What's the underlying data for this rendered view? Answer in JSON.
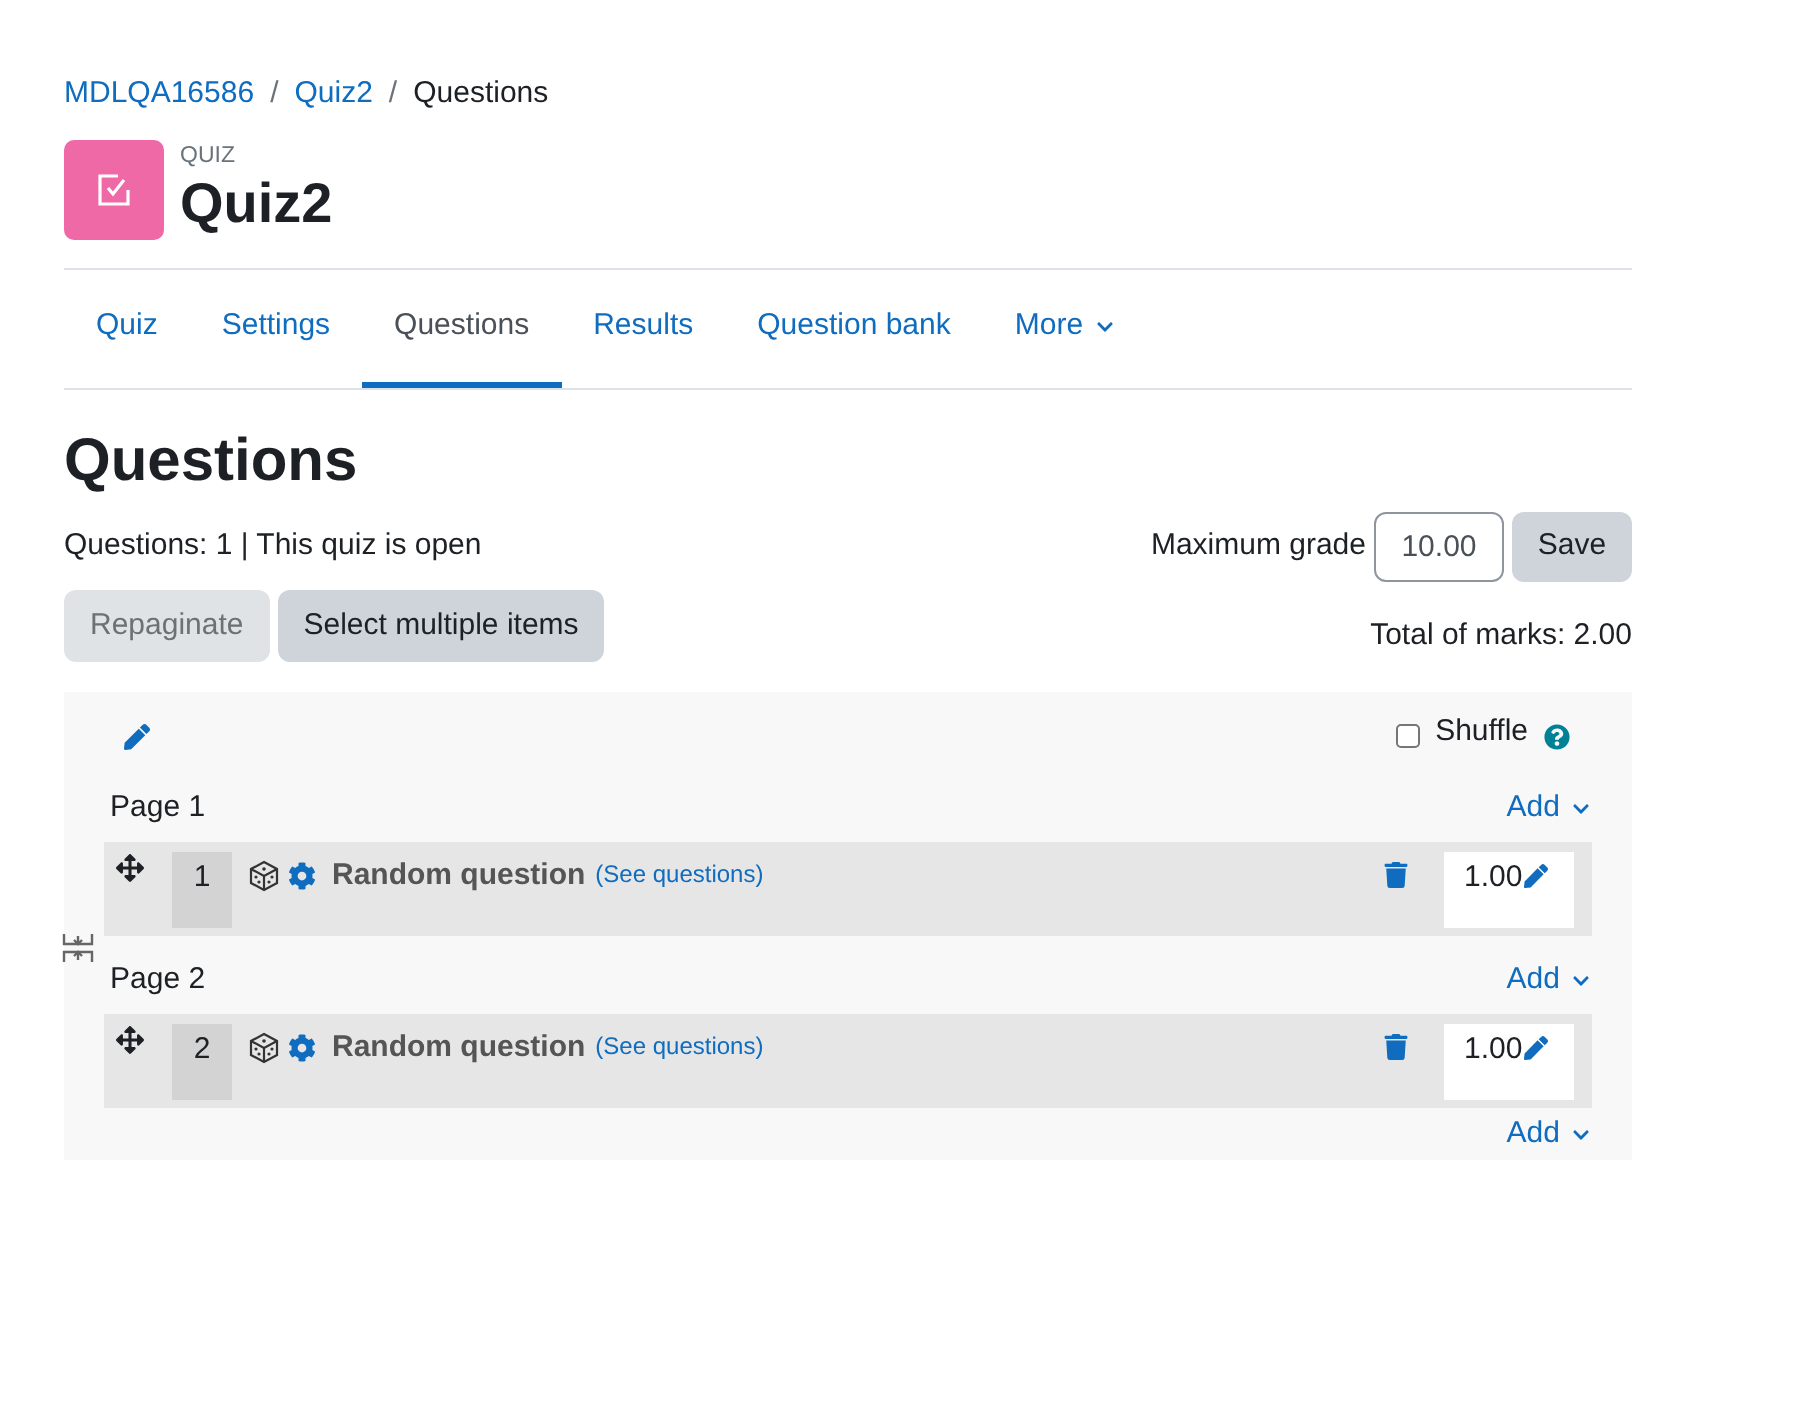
{
  "breadcrumb": [
    {
      "label": "MDLQA16586",
      "link": true
    },
    {
      "separator": "/",
      "label": "Quiz2",
      "link": true
    },
    {
      "separator": "/",
      "label": "Questions",
      "link": false
    }
  ],
  "header": {
    "module_type": "QUIZ",
    "title": "Quiz2"
  },
  "tabs": [
    {
      "label": "Quiz",
      "selected": false,
      "dropdown": false
    },
    {
      "label": "Settings",
      "selected": false,
      "dropdown": false
    },
    {
      "label": "Questions",
      "selected": true,
      "dropdown": false
    },
    {
      "label": "Results",
      "selected": false,
      "dropdown": false
    },
    {
      "label": "Question bank",
      "selected": false,
      "dropdown": false
    },
    {
      "label": "More",
      "selected": false,
      "dropdown": true
    }
  ],
  "heading": "Questions",
  "status": "Questions: 1 | This quiz is open",
  "maximum_grade": {
    "label": "Maximum grade",
    "value": "10.00",
    "button": "Save"
  },
  "buttons": [
    {
      "label": "Repaginate",
      "disabled": true
    },
    {
      "label": "Select multiple items",
      "disabled": false
    }
  ],
  "total_marks": "Total of marks: 2.00",
  "shuffle": {
    "label": "Shuffle",
    "checked": false
  },
  "pages": [
    {
      "label": "Page 1",
      "add": "Add",
      "questions": [
        {
          "number": "1",
          "name": "Random question",
          "link": "(See questions)",
          "mark": "1.00"
        }
      ]
    },
    {
      "label": "Page 2",
      "add": "Add",
      "questions": [
        {
          "number": "2",
          "name": "Random question",
          "link": "(See questions)",
          "mark": "1.00"
        }
      ]
    }
  ],
  "final_add": "Add"
}
